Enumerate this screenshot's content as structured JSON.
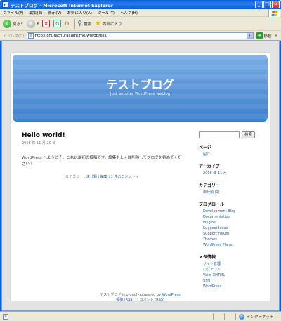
{
  "window": {
    "title": "テストブログ - Microsoft Internet Explorer",
    "minimize_glyph": "_",
    "maximize_glyph": "□",
    "close_glyph": "×"
  },
  "menubar": {
    "items": [
      {
        "label": "ファイル(F)"
      },
      {
        "label": "編集(E)"
      },
      {
        "label": "表示(V)"
      },
      {
        "label": "お気に入り(A)"
      },
      {
        "label": "ツール(T)"
      },
      {
        "label": "ヘルプ(H)"
      }
    ]
  },
  "toolbar": {
    "back_label": "戻る",
    "search_label": "検索",
    "favorites_label": "お気に入り"
  },
  "address": {
    "label": "アドレス(D)",
    "url": "http://churachurasumi.me/wordpress/",
    "go_label": "移動",
    "links_label": "»"
  },
  "blog": {
    "title": "テストブログ",
    "description": "Just another WordPress weblog"
  },
  "post": {
    "title": "Hello world!",
    "date": "2008 年 11 月 20 日",
    "body": "WordPress へようこそ。これは最初の投稿です。編集もしくは削除してブログを始めてください !",
    "category_label": "カテゴリー :",
    "category": "未分類",
    "edit": "編集",
    "comments": "1 件のコメント »",
    "separator": "|"
  },
  "sidebar": {
    "search_button": "検索",
    "widgets": [
      {
        "title": "ページ",
        "items": [
          "紹介"
        ]
      },
      {
        "title": "アーカイブ",
        "items": [
          "2008 年 11 月"
        ]
      },
      {
        "title": "カテゴリー",
        "items": [
          "未分類 (1)"
        ]
      },
      {
        "title": "ブログロール",
        "items": [
          "Development Blog",
          "Documentation",
          "Plugins",
          "Suggest Ideas",
          "Support Forum",
          "Themes",
          "WordPress Planet"
        ]
      },
      {
        "title": "メタ情報",
        "items": [
          "サイト管理",
          "ログアウト",
          "Valid XHTML",
          "XFN",
          "WordPress"
        ]
      }
    ]
  },
  "footer": {
    "line1_prefix": "テストブログ is proudly powered by",
    "line1_link": "WordPress",
    "entries_rss": "投稿 (RSS)",
    "and": "と",
    "comments_rss": "コメント (RSS)"
  },
  "statusbar": {
    "zone": "インターネット"
  }
}
